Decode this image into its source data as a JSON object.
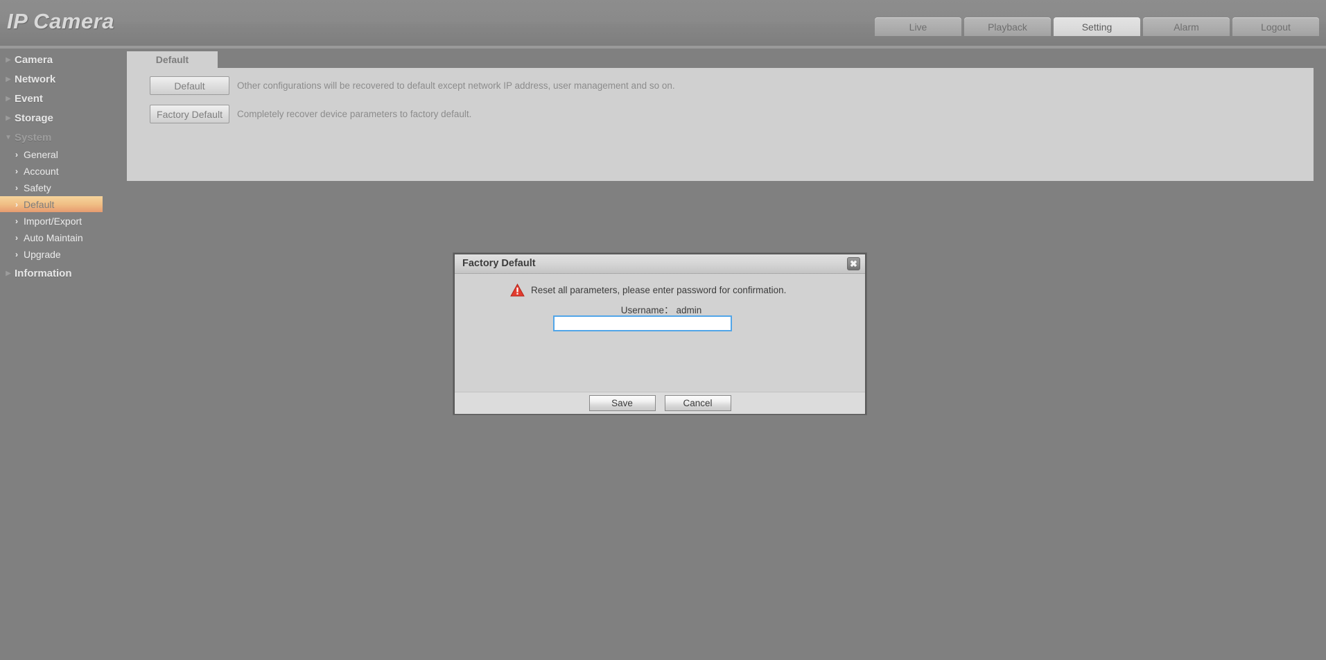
{
  "header": {
    "logo_text": "IP Camera",
    "nav_tabs": [
      {
        "label": "Live",
        "active": false
      },
      {
        "label": "Playback",
        "active": false
      },
      {
        "label": "Setting",
        "active": true
      },
      {
        "label": "Alarm",
        "active": false
      },
      {
        "label": "Logout",
        "active": false
      }
    ]
  },
  "sidebar": {
    "groups": [
      {
        "label": "Camera",
        "icon": "triangle-right-icon",
        "expanded": false
      },
      {
        "label": "Network",
        "icon": "triangle-right-icon",
        "expanded": false
      },
      {
        "label": "Event",
        "icon": "triangle-right-icon",
        "expanded": false
      },
      {
        "label": "Storage",
        "icon": "triangle-right-icon",
        "expanded": false
      },
      {
        "label": "System",
        "icon": "triangle-down-icon",
        "expanded": true
      }
    ],
    "system_items": [
      {
        "label": "General",
        "icon": "chevron-right-icon",
        "active": false
      },
      {
        "label": "Account",
        "icon": "chevron-right-icon",
        "active": false
      },
      {
        "label": "Safety",
        "icon": "chevron-right-icon",
        "active": false
      },
      {
        "label": "Default",
        "icon": "chevron-right-icon",
        "active": true
      },
      {
        "label": "Import/Export",
        "icon": "chevron-right-icon",
        "active": false
      },
      {
        "label": "Auto Maintain",
        "icon": "chevron-right-icon",
        "active": false
      },
      {
        "label": "Upgrade",
        "icon": "chevron-right-icon",
        "active": false
      }
    ],
    "trailing_group": {
      "label": "Information",
      "icon": "triangle-right-icon",
      "expanded": false
    }
  },
  "content": {
    "tab_label": "Default",
    "rows": [
      {
        "button_label": "Default",
        "description": "Other configurations will be recovered to default except network IP address, user management and so on."
      },
      {
        "button_label": "Factory Default",
        "description": "Completely recover device parameters to factory default."
      }
    ]
  },
  "dialog": {
    "title": "Factory Default",
    "close_icon": "close-x-icon",
    "warning_icon": "warning-triangle-icon",
    "warning_text": "Reset all parameters, please enter password for confirmation.",
    "username_label": "Username：",
    "username_value": "admin",
    "password_value": "",
    "password_placeholder": "",
    "save_label": "Save",
    "cancel_label": "Cancel"
  },
  "colors": {
    "page_background": "#808080",
    "header_background": "#8a8a8a",
    "panel_background": "#d0d0d0",
    "active_menu_gradient_top": "#f6d49c",
    "active_menu_gradient_bottom": "#e79b70",
    "input_focus_border": "#51a5e8",
    "warning_red": "#e23b2e",
    "dialog_background": "#d2d2d2"
  }
}
